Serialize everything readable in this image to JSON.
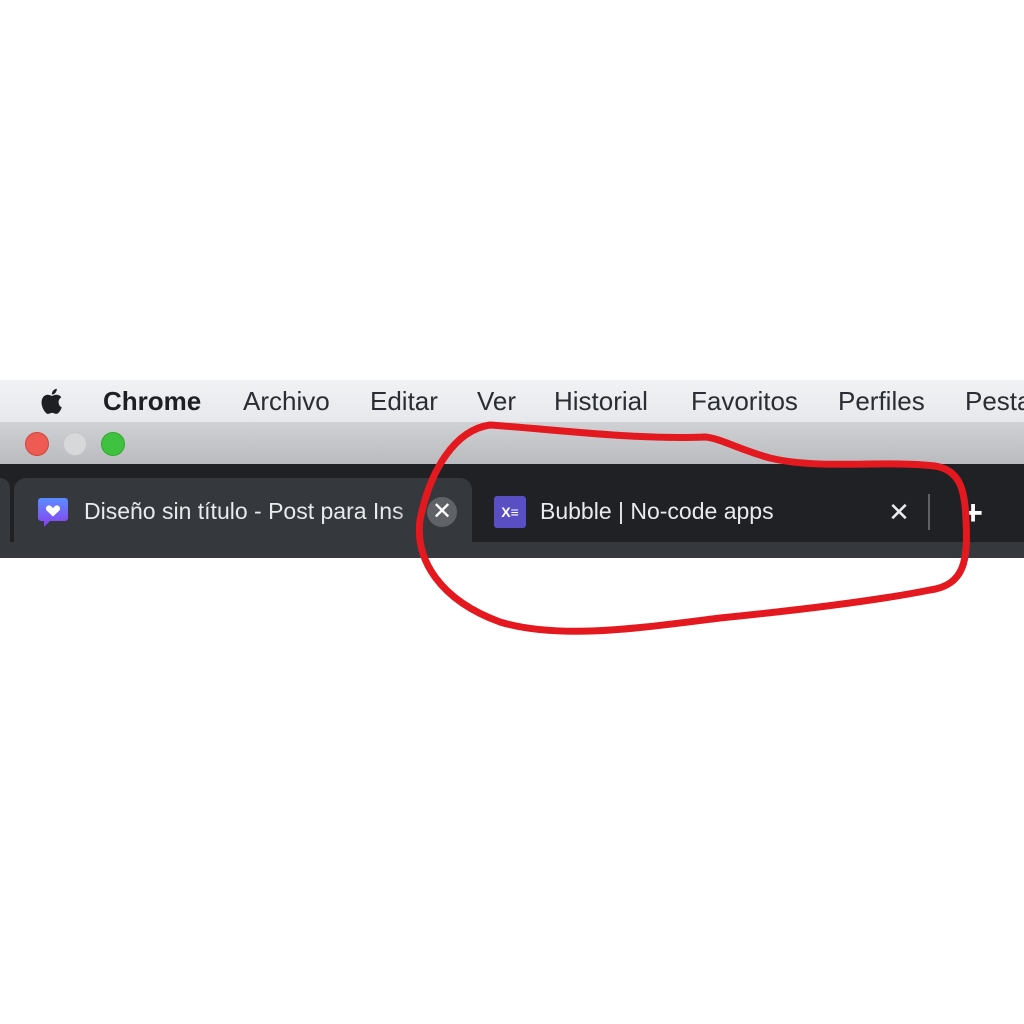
{
  "menubar": {
    "apple_icon": "apple-logo-icon",
    "app_name": "Chrome",
    "items": [
      "Archivo",
      "Editar",
      "Ver",
      "Historial",
      "Favoritos",
      "Perfiles",
      "Pesta"
    ]
  },
  "window": {
    "traffic_lights": [
      "close",
      "minimize",
      "zoom"
    ]
  },
  "tabs": [
    {
      "title": "Diseño sin título - Post para Ins",
      "favicon": "heart-chat-bubble-icon",
      "active": true,
      "close_icon": "close-icon"
    },
    {
      "title": "Bubble | No-code apps",
      "favicon": "bubble-logo-icon",
      "favicon_text": "X≡",
      "active": false,
      "close_icon": "close-icon"
    }
  ],
  "new_tab_label": "+",
  "colors": {
    "tabstrip": "#202124",
    "active_tab": "#35383c",
    "annotation": "#e3191f",
    "bubble_favicon": "#5a4fc2",
    "canva_favicon": "#7a4ef0"
  }
}
